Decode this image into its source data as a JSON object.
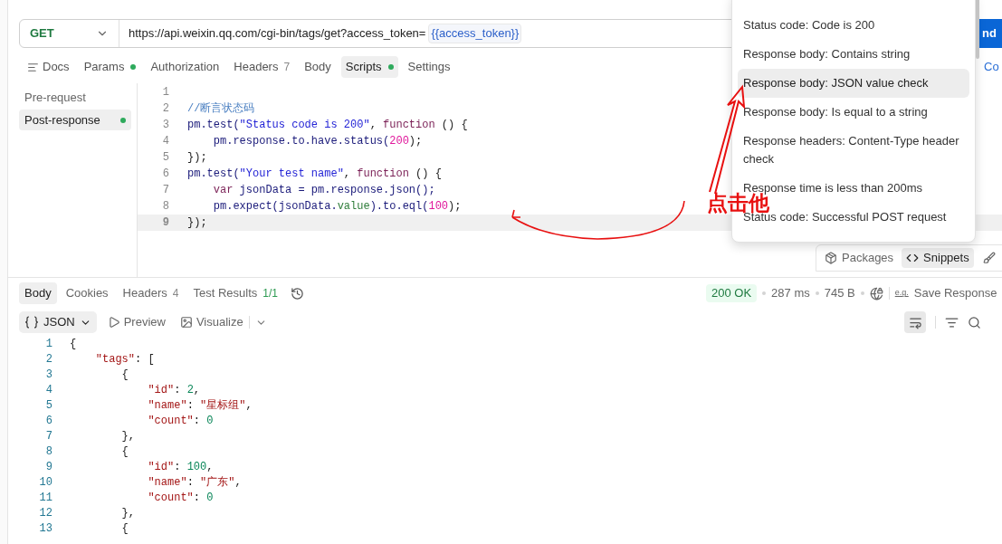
{
  "request": {
    "method": "GET",
    "url": "https://api.weixin.qq.com/cgi-bin/tags/get?access_token=",
    "variable": "{{access_token}}",
    "send_label": "nd",
    "side_link": "Co"
  },
  "request_tabs": [
    {
      "label": "Docs",
      "kind": "docs",
      "selected": false
    },
    {
      "label": "Params",
      "dot": true,
      "selected": false
    },
    {
      "label": "Authorization",
      "selected": false
    },
    {
      "label": "Headers",
      "count": "7",
      "selected": false
    },
    {
      "label": "Body",
      "selected": false
    },
    {
      "label": "Scripts",
      "dot": true,
      "selected": true
    },
    {
      "label": "Settings",
      "selected": false
    }
  ],
  "script_sections": [
    {
      "label": "Pre-request",
      "dot": false,
      "selected": false
    },
    {
      "label": "Post-response",
      "dot": true,
      "selected": true
    }
  ],
  "editor": {
    "lines": [
      {
        "number": "1"
      },
      {
        "number": "2",
        "tokens": [
          {
            "text": "//断言状态码",
            "kind": "comment"
          }
        ]
      },
      {
        "number": "3",
        "tokens": [
          {
            "text": "pm.test(",
            "kind": "ident"
          },
          {
            "text": "\"Status code is 200\"",
            "kind": "string"
          },
          {
            "text": ", ",
            "kind": "plain"
          },
          {
            "text": "function",
            "kind": "keyword"
          },
          {
            "text": " () {",
            "kind": "plain"
          }
        ]
      },
      {
        "number": "4",
        "tokens": [
          {
            "text": "    pm.response.to.have.status(",
            "kind": "ident"
          },
          {
            "text": "200",
            "kind": "number"
          },
          {
            "text": ");",
            "kind": "plain"
          }
        ]
      },
      {
        "number": "5",
        "tokens": [
          {
            "text": "});",
            "kind": "plain"
          }
        ]
      },
      {
        "number": "6",
        "tokens": [
          {
            "text": "pm.test(",
            "kind": "ident"
          },
          {
            "text": "\"Your test name\"",
            "kind": "string"
          },
          {
            "text": ", ",
            "kind": "plain"
          },
          {
            "text": "function",
            "kind": "keyword"
          },
          {
            "text": " () {",
            "kind": "plain"
          }
        ]
      },
      {
        "number": "7",
        "tokens": [
          {
            "text": "    var",
            "kind": "keyword"
          },
          {
            "text": " jsonData = pm.response.json();",
            "kind": "ident"
          }
        ]
      },
      {
        "number": "8",
        "tokens": [
          {
            "text": "    pm.expect(jsonData.",
            "kind": "ident"
          },
          {
            "text": "value",
            "kind": "prop"
          },
          {
            "text": ").to.eql(",
            "kind": "ident"
          },
          {
            "text": "100",
            "kind": "number"
          },
          {
            "text": ");",
            "kind": "plain"
          }
        ]
      },
      {
        "number": "9",
        "current": true,
        "tokens": [
          {
            "text": "});",
            "kind": "plain"
          }
        ]
      }
    ]
  },
  "editor_toolbar": [
    {
      "label": "Packages",
      "kind": "packages",
      "selected": false
    },
    {
      "label": "Snippets",
      "kind": "snippets",
      "selected": true
    }
  ],
  "snippets_menu": [
    {
      "label": "Status code: Code is 200",
      "selected": false
    },
    {
      "label": "Response body: Contains string",
      "selected": false
    },
    {
      "label": "Response body: JSON value check",
      "selected": true
    },
    {
      "label": "Response body: Is equal to a string",
      "selected": false
    },
    {
      "label": "Response headers: Content-Type header check",
      "selected": false
    },
    {
      "label": "Response time is less than 200ms",
      "selected": false
    },
    {
      "label": "Status code: Successful POST request",
      "selected": false
    }
  ],
  "annotation": {
    "label": "点击他"
  },
  "response_tabs": [
    {
      "label": "Body",
      "selected": true
    },
    {
      "label": "Cookies",
      "selected": false
    },
    {
      "label": "Headers",
      "count": "4",
      "selected": false
    },
    {
      "label": "Test Results",
      "count": "1/1",
      "passed": true,
      "selected": false
    }
  ],
  "response_meta": {
    "status": "200 OK",
    "time": "287 ms",
    "size": "745 B",
    "example_mark": "e.g.",
    "save_label": "Save Response"
  },
  "body_view": {
    "format": "JSON",
    "preview": "Preview",
    "visualize": "Visualize"
  },
  "response_body": [
    {
      "number": "1",
      "tokens": [
        {
          "text": "{",
          "kind": "plain"
        }
      ]
    },
    {
      "number": "2",
      "tokens": [
        {
          "text": "    \"tags\"",
          "kind": "key"
        },
        {
          "text": ": [",
          "kind": "plain"
        }
      ]
    },
    {
      "number": "3",
      "tokens": [
        {
          "text": "        {",
          "kind": "plain"
        }
      ]
    },
    {
      "number": "4",
      "tokens": [
        {
          "text": "            \"id\"",
          "kind": "key"
        },
        {
          "text": ": ",
          "kind": "plain"
        },
        {
          "text": "2",
          "kind": "number"
        },
        {
          "text": ",",
          "kind": "plain"
        }
      ]
    },
    {
      "number": "5",
      "tokens": [
        {
          "text": "            \"name\"",
          "kind": "key"
        },
        {
          "text": ": ",
          "kind": "plain"
        },
        {
          "text": "\"星标组\"",
          "kind": "string"
        },
        {
          "text": ",",
          "kind": "plain"
        }
      ]
    },
    {
      "number": "6",
      "tokens": [
        {
          "text": "            \"count\"",
          "kind": "key"
        },
        {
          "text": ": ",
          "kind": "plain"
        },
        {
          "text": "0",
          "kind": "number"
        }
      ]
    },
    {
      "number": "7",
      "tokens": [
        {
          "text": "        },",
          "kind": "plain"
        }
      ]
    },
    {
      "number": "8",
      "tokens": [
        {
          "text": "        {",
          "kind": "plain"
        }
      ]
    },
    {
      "number": "9",
      "tokens": [
        {
          "text": "            \"id\"",
          "kind": "key"
        },
        {
          "text": ": ",
          "kind": "plain"
        },
        {
          "text": "100",
          "kind": "number"
        },
        {
          "text": ",",
          "kind": "plain"
        }
      ]
    },
    {
      "number": "10",
      "tokens": [
        {
          "text": "            \"name\"",
          "kind": "key"
        },
        {
          "text": ": ",
          "kind": "plain"
        },
        {
          "text": "\"广东\"",
          "kind": "string"
        },
        {
          "text": ",",
          "kind": "plain"
        }
      ]
    },
    {
      "number": "11",
      "tokens": [
        {
          "text": "            \"count\"",
          "kind": "key"
        },
        {
          "text": ": ",
          "kind": "plain"
        },
        {
          "text": "0",
          "kind": "number"
        }
      ]
    },
    {
      "number": "12",
      "tokens": [
        {
          "text": "        },",
          "kind": "plain"
        }
      ]
    },
    {
      "number": "13",
      "tokens": [
        {
          "text": "        {",
          "kind": "plain"
        }
      ]
    }
  ]
}
